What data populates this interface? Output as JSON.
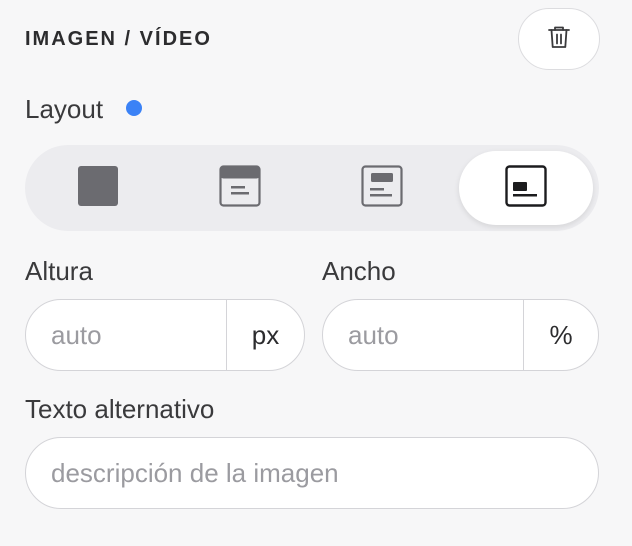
{
  "section": {
    "title": "IMAGEN / VÍDEO",
    "delete_icon": "trash-icon"
  },
  "layout": {
    "label": "Layout",
    "indicator_color": "#3b82f6",
    "options": [
      {
        "icon": "layout-full-icon",
        "active": false
      },
      {
        "icon": "layout-top-image-icon",
        "active": false
      },
      {
        "icon": "layout-center-image-icon",
        "active": false
      },
      {
        "icon": "layout-left-image-icon",
        "active": true
      }
    ]
  },
  "height": {
    "label": "Altura",
    "placeholder": "auto",
    "value": "",
    "unit": "px"
  },
  "width": {
    "label": "Ancho",
    "placeholder": "auto",
    "value": "",
    "unit": "%"
  },
  "alt_text": {
    "label": "Texto alternativo",
    "placeholder": "descripción de la imagen",
    "value": ""
  }
}
